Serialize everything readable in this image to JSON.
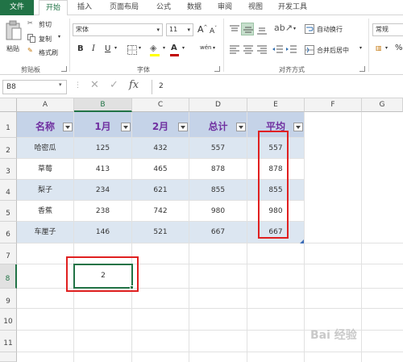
{
  "tabs": [
    "文件",
    "开始",
    "插入",
    "页面布局",
    "公式",
    "数据",
    "审阅",
    "视图",
    "开发工具"
  ],
  "ribbon": {
    "clipboard": {
      "paste": "粘贴",
      "cut": "剪切",
      "copy": "复制",
      "format_painter": "格式刷",
      "label": "剪贴板"
    },
    "font": {
      "name": "宋体",
      "size": "11",
      "grow": "A",
      "shrink": "A",
      "bold": "B",
      "italic": "I",
      "underline": "U",
      "label": "字体",
      "color_letter": "A",
      "wen": "wén"
    },
    "alignment": {
      "wrap": "自动换行",
      "merge": "合并后居中",
      "label": "对齐方式"
    },
    "number": {
      "format": "常规",
      "percent": "%"
    }
  },
  "formula_bar": {
    "name_box": "B8",
    "fx": "fx",
    "value": "2"
  },
  "columns": [
    "A",
    "B",
    "C",
    "D",
    "E",
    "F",
    "G"
  ],
  "rows": [
    "1",
    "2",
    "3",
    "4",
    "5",
    "6",
    "7",
    "8",
    "9",
    "10",
    "11"
  ],
  "table": {
    "headers": [
      "名称",
      "1月",
      "2月",
      "总计",
      "平均"
    ],
    "rows": [
      [
        "哈密瓜",
        "125",
        "432",
        "557",
        "557"
      ],
      [
        "草莓",
        "413",
        "465",
        "878",
        "878"
      ],
      [
        "梨子",
        "234",
        "621",
        "855",
        "855"
      ],
      [
        "香蕉",
        "238",
        "742",
        "980",
        "980"
      ],
      [
        "车厘子",
        "146",
        "521",
        "667",
        "667"
      ]
    ]
  },
  "selected_cell_value": "2",
  "watermark": "Bai 经验"
}
